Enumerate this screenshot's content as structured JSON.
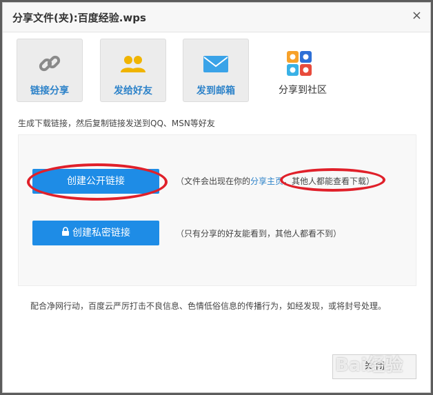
{
  "dialog": {
    "title": "分享文件(夹):百度经验.wps",
    "close_glyph": "×"
  },
  "tabs": [
    {
      "label": "链接分享",
      "icon": "link-icon"
    },
    {
      "label": "发给好友",
      "icon": "friends-icon"
    },
    {
      "label": "发到邮箱",
      "icon": "mail-icon"
    },
    {
      "label": "分享到社区",
      "icon": "community-icon"
    }
  ],
  "description": "生成下载链接，然后复制链接发送到QQ、MSN等好友",
  "public_link": {
    "button_label": "创建公开链接",
    "note_prefix": "（文件会出现在你的",
    "note_link": "分享主页",
    "note_suffix": "，其他人都能查看下载）"
  },
  "private_link": {
    "button_label": "创建私密链接",
    "note": "（只有分享的好友能看到，其他人都看不到）"
  },
  "footer_note": "配合净网行动，百度云严厉打击不良信息、色情低俗信息的传播行为，如经发现，或将封号处理。",
  "close_button_label": "关 闭",
  "colors": {
    "accent": "#1e8ce6",
    "link": "#2c82c9",
    "annotation_red": "#e0202a"
  }
}
